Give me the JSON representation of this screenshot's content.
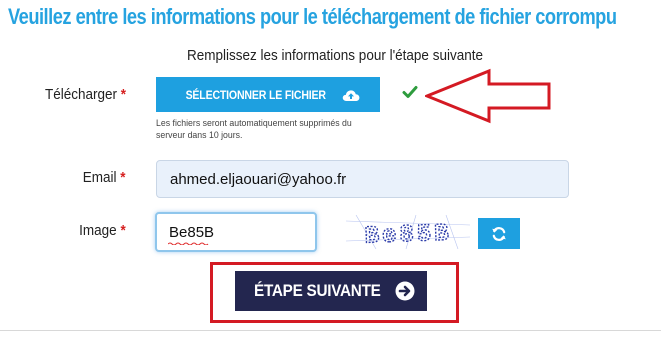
{
  "page": {
    "title": "Veuillez entre les informations pour le téléchargement de fichier corrompu",
    "subtitle": "Remplissez les informations pour l'étape suivante"
  },
  "form": {
    "upload": {
      "label": "Télécharger",
      "required_mark": "*",
      "button_label": "SÉLECTIONNER LE FICHIER",
      "button_icon": "cloud-upload-icon",
      "status_icon": "checkmark-icon",
      "help_text": "Les fichiers seront automatiquement supprimés du serveur dans 10 jours."
    },
    "email": {
      "label": "Email",
      "required_mark": "*",
      "value": "ahmed.eljaouari@yahoo.fr"
    },
    "captcha": {
      "label": "Image",
      "required_mark": "*",
      "value": "Be85B",
      "image_text": "Be85B",
      "refresh_icon": "refresh-icon"
    },
    "submit": {
      "label": "ÉTAPE SUIVANTE",
      "icon": "arrow-right-circle-icon"
    }
  },
  "colors": {
    "title": "#26a3e0",
    "primary_button": "#1ea0e0",
    "submit_button": "#23264f",
    "required": "#d62020",
    "check": "#2e9c3e",
    "annotation": "#d41a23"
  }
}
